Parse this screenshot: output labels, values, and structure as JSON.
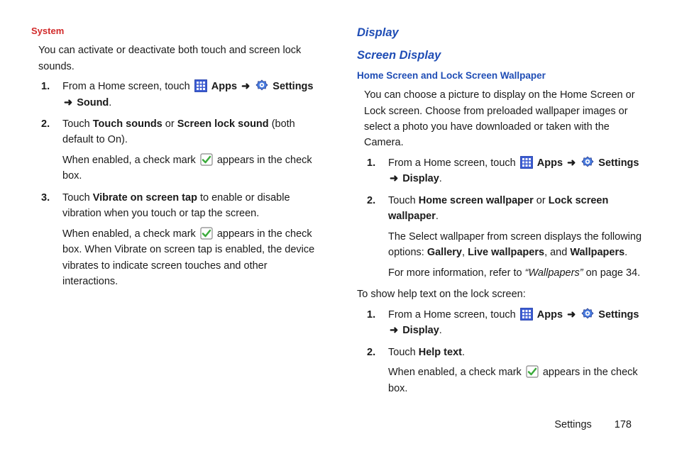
{
  "left": {
    "heading_system": "System",
    "intro": "You can activate or deactivate both touch and screen lock sounds.",
    "step1_a": "From a Home screen, touch",
    "step1_apps": "Apps",
    "step1_settings": "Settings",
    "step1_sound": "Sound",
    "step2_a": "Touch",
    "step2_touch_sounds": "Touch sounds",
    "step2_or": "or",
    "step2_screen_lock": "Screen lock sound",
    "step2_b": "(both default to On).",
    "step2_sub_a": "When enabled, a check mark",
    "step2_sub_b": "appears in the check box.",
    "step3_a": "Touch",
    "step3_vibrate": "Vibrate on screen tap",
    "step3_b": "to enable or disable vibration when you touch or tap the screen.",
    "step3_sub_a": "When enabled, a check mark",
    "step3_sub_b": "appears in the check box. When Vibrate on screen tap is enabled, the device vibrates to indicate screen touches and other interactions."
  },
  "right": {
    "heading_display": "Display",
    "heading_screen_display": "Screen Display",
    "heading_wallpaper": "Home Screen and Lock Screen Wallpaper",
    "intro": "You can choose a picture to display on the Home Screen or Lock screen. Choose from preloaded wallpaper images or select a photo you have downloaded or taken with the Camera.",
    "step1_a": "From a Home screen, touch",
    "step1_apps": "Apps",
    "step1_settings": "Settings",
    "step1_display": "Display",
    "step2_a": "Touch",
    "step2_home": "Home screen wallpaper",
    "step2_or": "or",
    "step2_lock": "Lock screen wallpaper",
    "step2_sub1_a": "The Select wallpaper from screen displays the following options:",
    "step2_gallery": "Gallery",
    "step2_live": "Live wallpapers",
    "step2_and": ", and",
    "step2_wallpapers": "Wallpapers",
    "step2_sub2_a": "For more information, refer to",
    "step2_sub2_ref": "“Wallpapers”",
    "step2_sub2_b": "on page 34.",
    "help_intro": "To show help text on the lock screen:",
    "hstep1_a": "From a Home screen, touch",
    "hstep1_apps": "Apps",
    "hstep1_settings": "Settings",
    "hstep1_display": "Display",
    "hstep2_a": "Touch",
    "hstep2_help": "Help text",
    "hstep2_sub_a": "When enabled, a check mark",
    "hstep2_sub_b": "appears in the check box."
  },
  "arrow": "➜",
  "footer": {
    "section": "Settings",
    "page": "178"
  }
}
